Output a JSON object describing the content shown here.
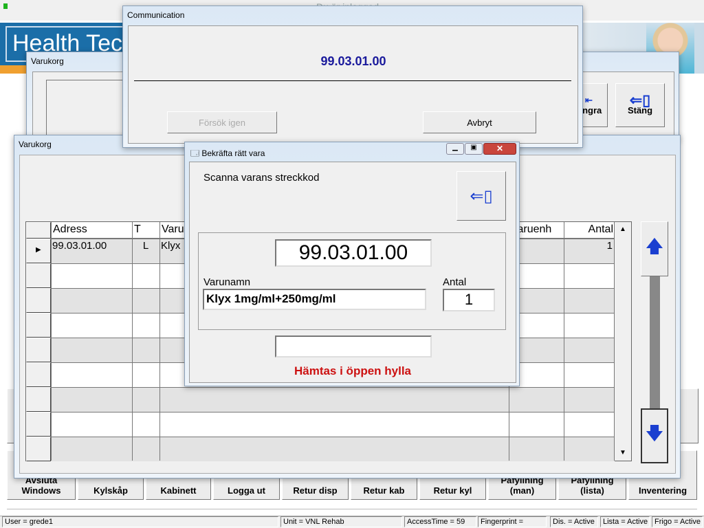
{
  "main": {
    "banner_text": "Du är inloggad",
    "logo_text": "Health Tec",
    "buttons": [
      "Avsluta Windows",
      "Kylskåp",
      "Kabinett",
      "Logga ut",
      "Retur disp",
      "Retur kab",
      "Retur kyl",
      "Påfyllning (man)",
      "Påfyllning (lista)",
      "Inventering"
    ]
  },
  "status": {
    "user": "User = grede1",
    "unit": "Unit = VNL Rehab",
    "access": "AccessTime =  59",
    "fingerprint": "Fingerprint =",
    "dis": "Dis. = Active",
    "lista": "Lista = Active",
    "frigo": "Frigo = Active"
  },
  "varukorg_back": {
    "title": "Varukorg",
    "angra": "Ångra",
    "stang": "Stäng"
  },
  "varukorg": {
    "title": "Varukorg",
    "columns": [
      "Adress",
      "T",
      "Varu",
      "Varuenh",
      "Antal"
    ],
    "rows": [
      {
        "adress": "99.03.01.00",
        "t": "L",
        "varu": "Klyx",
        "varuenh": "",
        "antal": "1"
      }
    ]
  },
  "communication": {
    "title": "Communication",
    "code": "99.03.01.00",
    "retry": "Försök igen",
    "cancel": "Avbryt",
    "code_color": "#1a1a9c"
  },
  "confirm": {
    "title": "Bekräfta rätt vara",
    "instruction": "Scanna varans streckkod",
    "code": "99.03.01.00",
    "name_label": "Varunamn",
    "name_value": "Klyx 1mg/ml+250mg/ml",
    "qty_label": "Antal",
    "qty_value": "1",
    "scan_value": "",
    "message": "Hämtas i öppen hylla",
    "message_color": "#cc1111"
  }
}
